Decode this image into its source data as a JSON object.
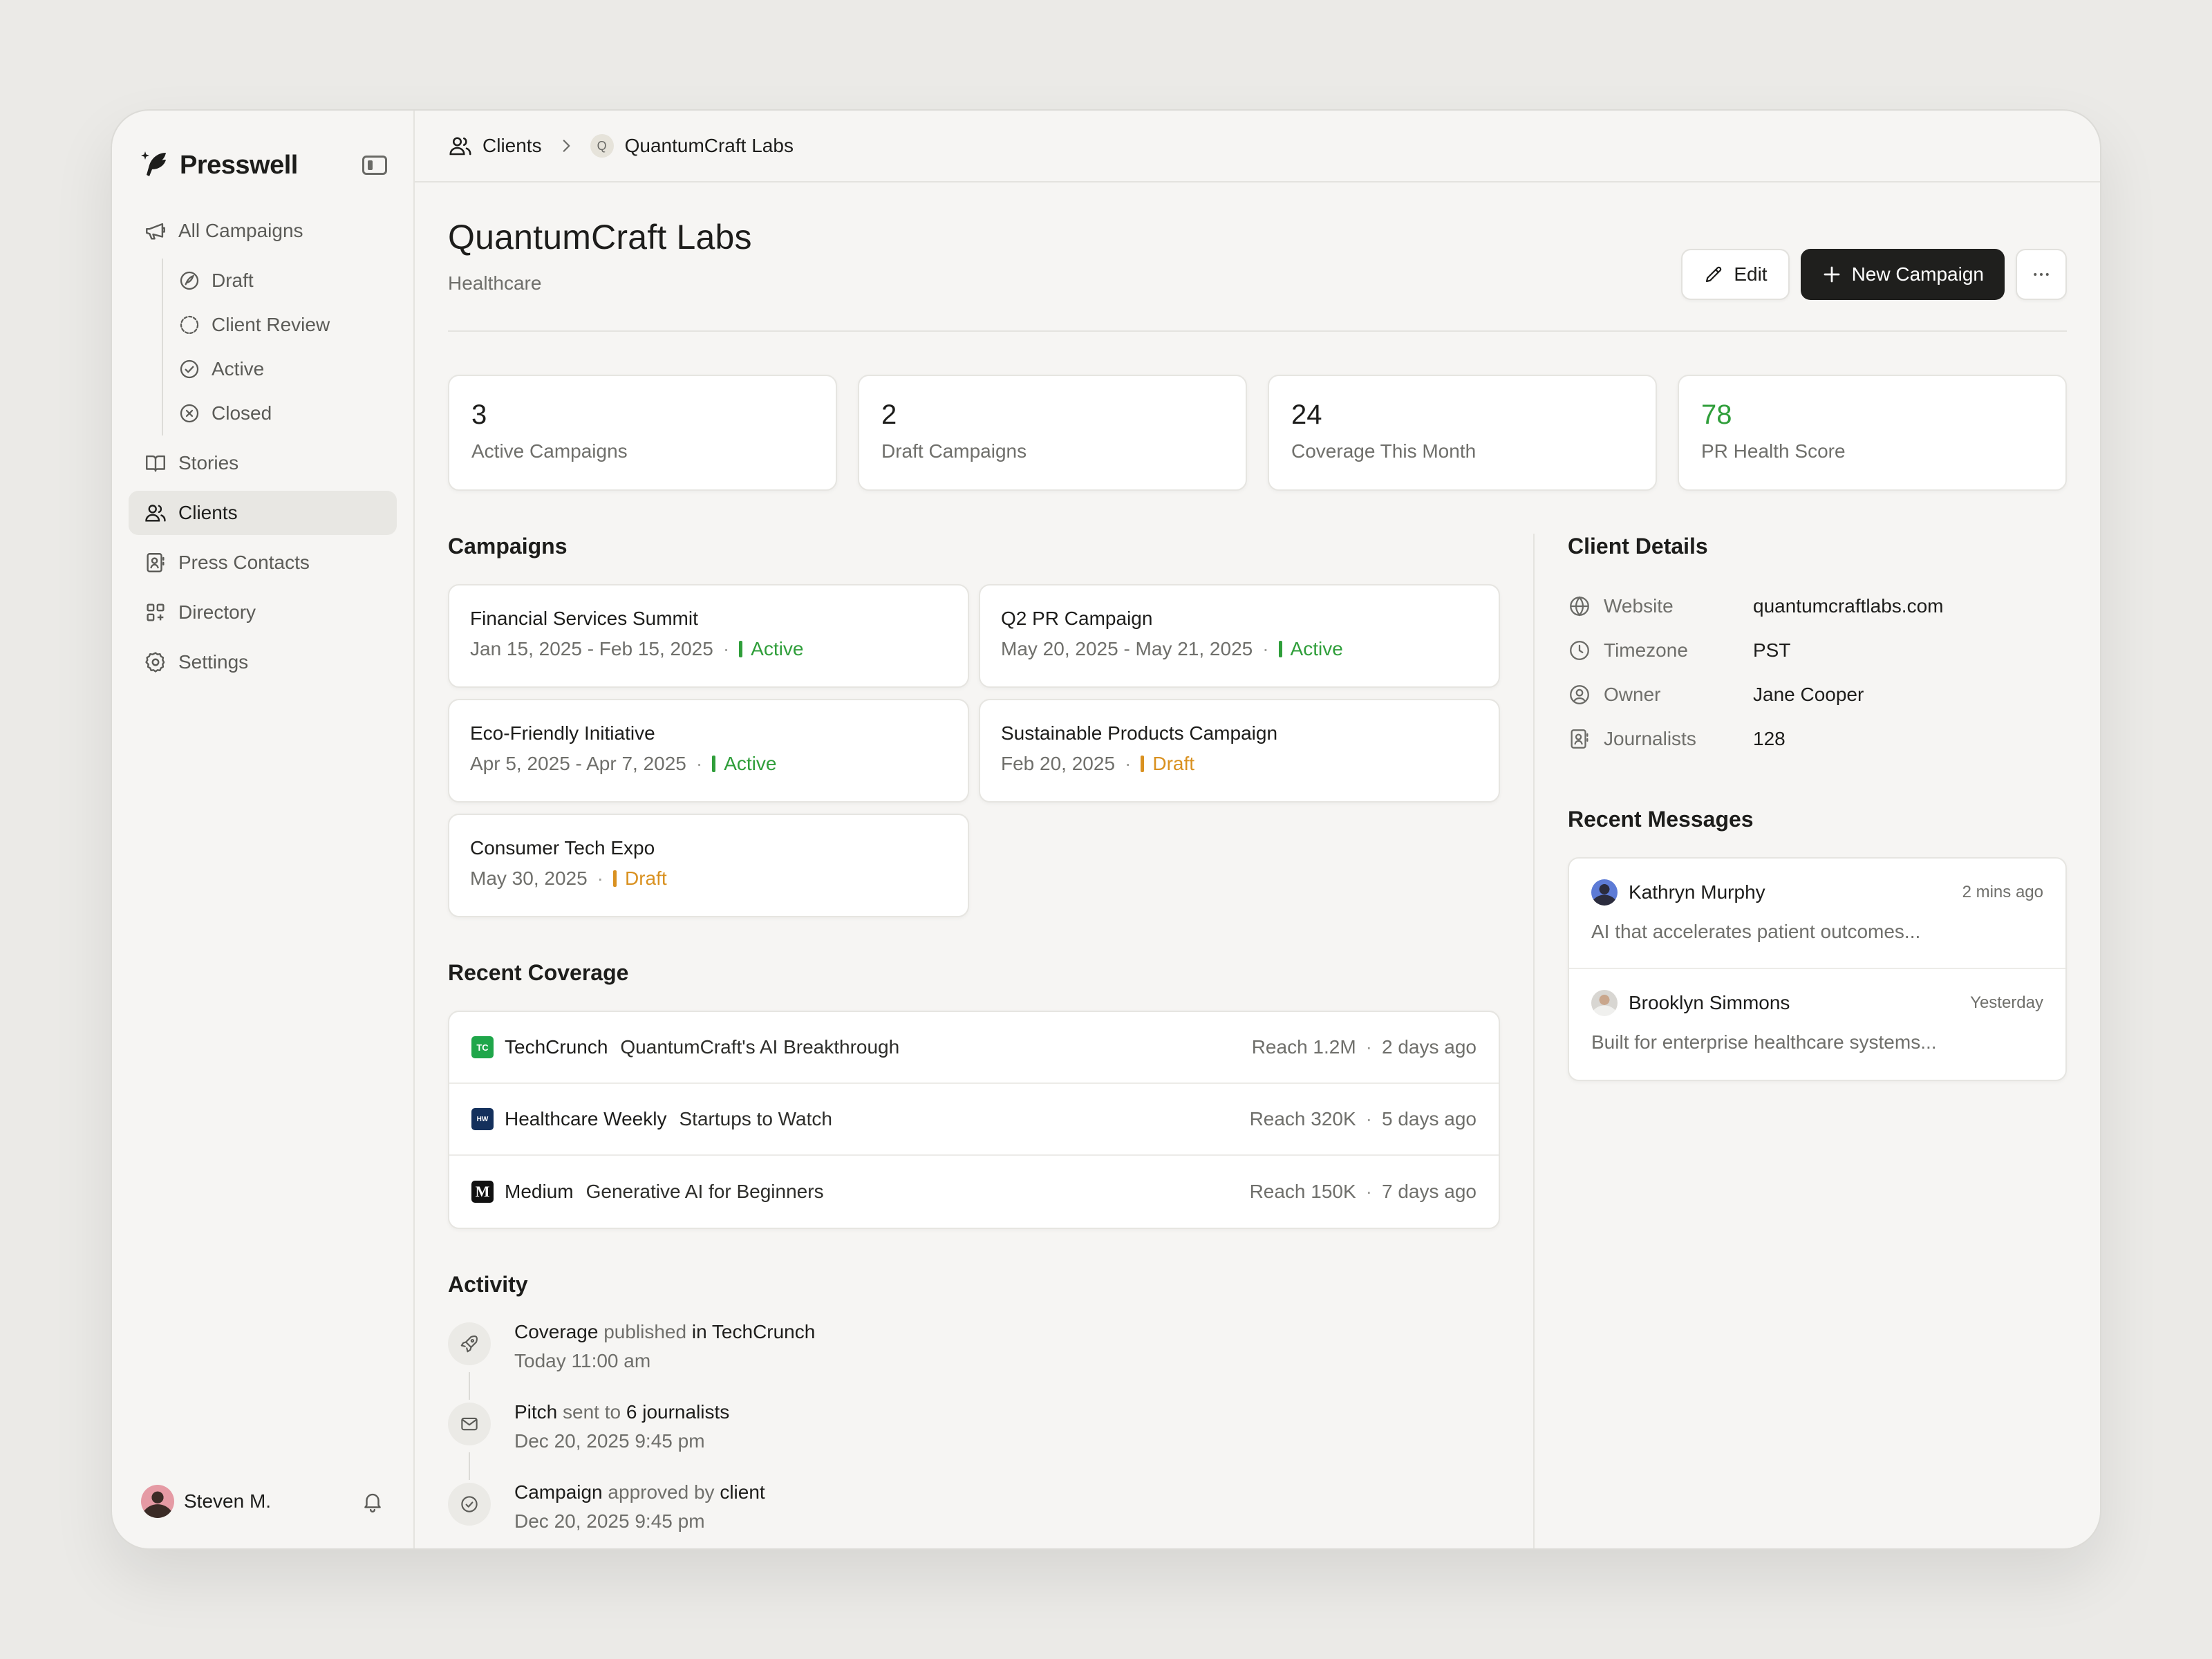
{
  "app": {
    "name": "Presswell"
  },
  "sidebar": {
    "all_campaigns": "All Campaigns",
    "sub_items": [
      {
        "label": "Draft",
        "icon": "draft-icon"
      },
      {
        "label": "Client Review",
        "icon": "clock-dashed-icon"
      },
      {
        "label": "Active",
        "icon": "check-circle-icon"
      },
      {
        "label": "Closed",
        "icon": "x-circle-icon"
      }
    ],
    "items": [
      {
        "label": "Stories",
        "icon": "book-icon"
      },
      {
        "label": "Clients",
        "icon": "users-icon",
        "active": true
      },
      {
        "label": "Press Contacts",
        "icon": "contact-book-icon"
      },
      {
        "label": "Directory",
        "icon": "grid-icon"
      },
      {
        "label": "Settings",
        "icon": "gear-icon"
      }
    ],
    "user": {
      "name": "Steven M."
    }
  },
  "breadcrumb": {
    "root": "Clients",
    "avatar_letter": "Q",
    "current": "QuantumCraft Labs"
  },
  "header": {
    "title": "QuantumCraft Labs",
    "subtitle": "Healthcare",
    "edit_label": "Edit",
    "new_campaign_label": "New Campaign"
  },
  "stats": [
    {
      "value": "3",
      "label": "Active Campaigns"
    },
    {
      "value": "2",
      "label": "Draft Campaigns"
    },
    {
      "value": "24",
      "label": "Coverage This Month"
    },
    {
      "value": "78",
      "label": "PR Health Score",
      "color": "#2f9e3a"
    }
  ],
  "campaigns": {
    "title": "Campaigns",
    "items": [
      {
        "name": "Financial Services Summit",
        "dates": "Jan 15, 2025 - Feb 15, 2025",
        "status": "Active"
      },
      {
        "name": "Q2 PR Campaign",
        "dates": "May 20, 2025 - May 21, 2025",
        "status": "Active"
      },
      {
        "name": "Eco-Friendly Initiative",
        "dates": "Apr 5, 2025 - Apr 7, 2025",
        "status": "Active"
      },
      {
        "name": "Sustainable Products Campaign",
        "dates": "Feb 20, 2025",
        "status": "Draft"
      },
      {
        "name": "Consumer Tech Expo",
        "dates": "May 30, 2025",
        "status": "Draft"
      }
    ]
  },
  "coverage": {
    "title": "Recent Coverage",
    "items": [
      {
        "outlet": "TechCrunch",
        "logo_text": "TC",
        "logo_color": "#1fa64a",
        "headline": "QuantumCraft's AI Breakthrough",
        "reach": "Reach 1.2M",
        "when": "2 days ago"
      },
      {
        "outlet": "Healthcare Weekly",
        "logo_text": "HW",
        "logo_color": "#14305c",
        "headline": "Startups to Watch",
        "reach": "Reach 320K",
        "when": "5 days ago"
      },
      {
        "outlet": "Medium",
        "logo_text": "M",
        "logo_color": "#111111",
        "headline": "Generative AI for Beginners",
        "reach": "Reach 150K",
        "when": "7 days ago"
      }
    ]
  },
  "activity": {
    "title": "Activity",
    "items": [
      {
        "subject": "Coverage",
        "verb": "published",
        "prep": "in",
        "object": "TechCrunch",
        "time": "Today 11:00 am",
        "icon": "rocket-icon"
      },
      {
        "subject": "Pitch",
        "verb": "sent",
        "prep": "to",
        "object": "6 journalists",
        "time": "Dec 20, 2025 9:45 pm",
        "icon": "mail-icon"
      },
      {
        "subject": "Campaign",
        "verb": "approved",
        "prep": "by",
        "object": "client",
        "time": "Dec 20, 2025 9:45 pm",
        "icon": "check-circle-icon"
      }
    ]
  },
  "client_details": {
    "title": "Client Details",
    "rows": [
      {
        "label": "Website",
        "value": "quantumcraftlabs.com",
        "icon": "globe-icon"
      },
      {
        "label": "Timezone",
        "value": "PST",
        "icon": "clock-icon"
      },
      {
        "label": "Owner",
        "value": "Jane Cooper",
        "icon": "user-circle-icon"
      },
      {
        "label": "Journalists",
        "value": "128",
        "icon": "contact-book-icon"
      }
    ]
  },
  "messages": {
    "title": "Recent Messages",
    "items": [
      {
        "name": "Kathryn Murphy",
        "time": "2 mins ago",
        "body": "AI that accelerates patient outcomes..."
      },
      {
        "name": "Brooklyn Simmons",
        "time": "Yesterday",
        "body": "Built for enterprise healthcare systems..."
      }
    ]
  }
}
